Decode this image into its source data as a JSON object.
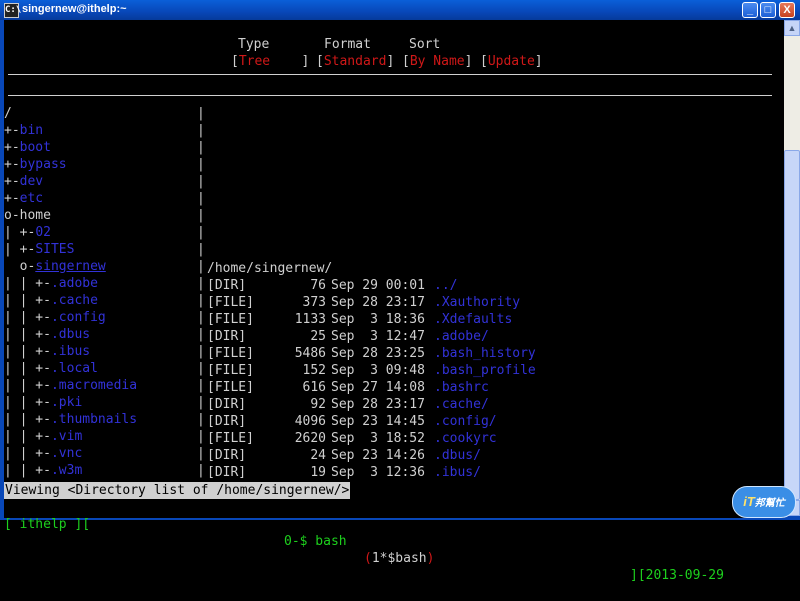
{
  "window": {
    "title": "singernew@ithelp:~",
    "icon_label": "C:\\",
    "minimize": "_",
    "maximize": "□",
    "close": "X"
  },
  "header": {
    "type_label": "Type",
    "format_label": "Format",
    "sort_label": "Sort",
    "type_value": "Tree",
    "format_value": "Standard",
    "sort_value": "By Name",
    "update": "Update"
  },
  "tree": [
    {
      "prefix": "/",
      "name": "",
      "color": "b"
    },
    {
      "prefix": "+-",
      "name": "bin",
      "color": "b"
    },
    {
      "prefix": "+-",
      "name": "boot",
      "color": "b"
    },
    {
      "prefix": "+-",
      "name": "bypass",
      "color": "b"
    },
    {
      "prefix": "+-",
      "name": "dev",
      "color": "b"
    },
    {
      "prefix": "+-",
      "name": "etc",
      "color": "b"
    },
    {
      "prefix": "o-",
      "name": "home",
      "color": "w"
    },
    {
      "prefix": "| +-",
      "name": "02",
      "color": "b"
    },
    {
      "prefix": "| +-",
      "name": "SITES",
      "color": "b"
    },
    {
      "prefix": "  o-",
      "name": "singernew",
      "color": "b",
      "underline": true
    },
    {
      "prefix": "| | +-",
      "name": ".adobe",
      "color": "b"
    },
    {
      "prefix": "| | +-",
      "name": ".cache",
      "color": "b"
    },
    {
      "prefix": "| | +-",
      "name": ".config",
      "color": "b"
    },
    {
      "prefix": "| | +-",
      "name": ".dbus",
      "color": "b"
    },
    {
      "prefix": "| | +-",
      "name": ".ibus",
      "color": "b"
    },
    {
      "prefix": "| | +-",
      "name": ".local",
      "color": "b"
    },
    {
      "prefix": "| | +-",
      "name": ".macromedia",
      "color": "b"
    },
    {
      "prefix": "| | +-",
      "name": ".pki",
      "color": "b"
    },
    {
      "prefix": "| | +-",
      "name": ".thumbnails",
      "color": "b"
    },
    {
      "prefix": "| | +-",
      "name": ".vim",
      "color": "b"
    },
    {
      "prefix": "| | +-",
      "name": ".vnc",
      "color": "b"
    },
    {
      "prefix": "| | +-",
      "name": ".w3m",
      "color": "b"
    }
  ],
  "listing": {
    "path": "/home/singernew/",
    "rows": [
      {
        "type": "[DIR]",
        "size": "76",
        "date": "Sep 29 00:01",
        "name": "../"
      },
      {
        "type": "[FILE]",
        "size": "373",
        "date": "Sep 28 23:17",
        "name": ".Xauthority"
      },
      {
        "type": "[FILE]",
        "size": "1133",
        "date": "Sep  3 18:36",
        "name": ".Xdefaults"
      },
      {
        "type": "[DIR]",
        "size": "25",
        "date": "Sep  3 12:47",
        "name": ".adobe/"
      },
      {
        "type": "[FILE]",
        "size": "5486",
        "date": "Sep 28 23:25",
        "name": ".bash_history"
      },
      {
        "type": "[FILE]",
        "size": "152",
        "date": "Sep  3 09:48",
        "name": ".bash_profile"
      },
      {
        "type": "[FILE]",
        "size": "616",
        "date": "Sep 27 14:08",
        "name": ".bashrc"
      },
      {
        "type": "[DIR]",
        "size": "92",
        "date": "Sep 28 23:17",
        "name": ".cache/"
      },
      {
        "type": "[DIR]",
        "size": "4096",
        "date": "Sep 23 14:45",
        "name": ".config/"
      },
      {
        "type": "[FILE]",
        "size": "2620",
        "date": "Sep  3 18:52",
        "name": ".cookyrc"
      },
      {
        "type": "[DIR]",
        "size": "24",
        "date": "Sep 23 14:26",
        "name": ".dbus/"
      },
      {
        "type": "[DIR]",
        "size": "19",
        "date": "Sep  3 12:36",
        "name": ".ibus/"
      }
    ]
  },
  "status": "Viewing <Directory list of /home/singernew/>",
  "screen_bar": {
    "host": "[ ithelp ][",
    "win0": "0-$ bash",
    "win1": "(1*$bash)",
    "date": "][2013-09-29"
  },
  "logo": {
    "text1": "iT",
    "text2": "邦幫忙"
  }
}
